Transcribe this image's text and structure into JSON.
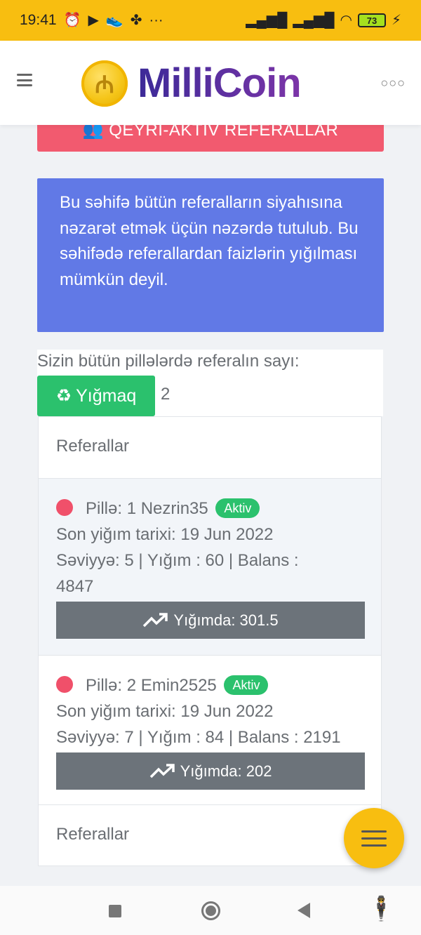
{
  "status_bar": {
    "time": "19:41",
    "icons_left": [
      "alarm-icon",
      "play-icon",
      "shoe-icon",
      "fan-icon",
      "more-icon"
    ],
    "battery": "73"
  },
  "header": {
    "logo_symbol": "₼",
    "app_name": "MilliCoin"
  },
  "inactive_button": {
    "label": "QEYRİ-AKTİV REFERALLAR"
  },
  "info_text": "Bu səhifə bütün referalların siyahısına nəzarət etmək üçün nəzərdə tutulub. Bu səhifədə referallardan faizlərin yığılması mümkün deyil.",
  "summary": {
    "label": "Sizin bütün pillələrdə referalın sayı:",
    "collect_label": "Yığmaq",
    "count": "2"
  },
  "panel": {
    "header": "Referallar",
    "footer": "Referallar",
    "items": [
      {
        "title": "Pillə: 1 Nezrin35",
        "status": "Aktiv",
        "last_collect": "Son yiğım tarixi:  19 Jun 2022",
        "stats_line1": "Səviyyə: 5 | Yığım : 60 | Balans :",
        "stats_line2": "4847",
        "gain": "Yığımda: 301.5"
      },
      {
        "title": "Pillə: 2 Emin2525",
        "status": "Aktiv",
        "last_collect": "Son yiğım tarixi:  19 Jun 2022",
        "stats_line1": "Səviyyə: 7 | Yığım : 84 | Balans : 2191",
        "gain": "Yığımda: 202"
      }
    ]
  },
  "colors": {
    "status_bar": "#f8be10",
    "danger": "#f25a6f",
    "info": "#6179e6",
    "success": "#2bc16d",
    "secondary": "#6c737a"
  }
}
